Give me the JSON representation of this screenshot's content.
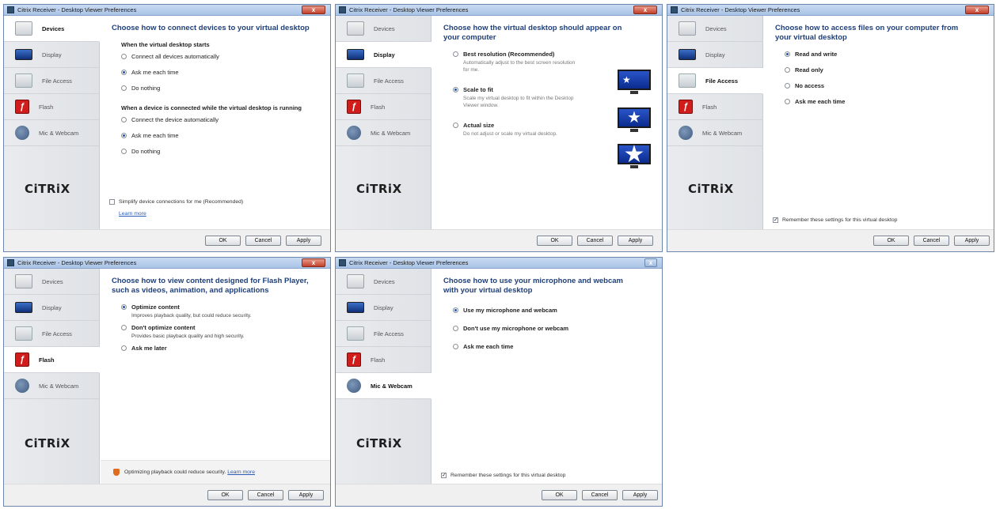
{
  "window_title": "Citrix Receiver - Desktop Viewer Preferences",
  "close_glyph": "x",
  "nav": [
    "Devices",
    "Display",
    "File Access",
    "Flash",
    "Mic & Webcam"
  ],
  "logo_text": "CiTRiX",
  "buttons": {
    "ok": "OK",
    "cancel": "Cancel",
    "apply": "Apply"
  },
  "devices": {
    "heading": "Choose how to connect devices to your virtual desktop",
    "group1_label": "When the virtual desktop starts",
    "group1_options": [
      "Connect all devices automatically",
      "Ask me each time",
      "Do nothing"
    ],
    "group1_selected": 1,
    "group2_label": "When a device is connected while the virtual desktop is running",
    "group2_options": [
      "Connect the device automatically",
      "Ask me each time",
      "Do nothing"
    ],
    "group2_selected": 1,
    "simplify_label": "Simplify device connections for me (Recommended)",
    "learn_more": "Learn more"
  },
  "display": {
    "heading": "Choose how the virtual desktop should appear on your computer",
    "options": [
      {
        "label": "Best resolution (Recommended)",
        "desc": "Automatically adjust to the best screen resolution for me."
      },
      {
        "label": "Scale to fit",
        "desc": "Scale my virtual desktop to fit within the Desktop Viewer window."
      },
      {
        "label": "Actual size",
        "desc": "Do not adjust or scale my virtual desktop."
      }
    ],
    "selected": 1,
    "star_glyph": "★"
  },
  "file_access": {
    "heading": "Choose how to access files on your computer from your virtual desktop",
    "options": [
      "Read and write",
      "Read only",
      "No access",
      "Ask me each time"
    ],
    "selected": 0,
    "remember_label": "Remember these settings for this virtual desktop"
  },
  "flash": {
    "heading": "Choose how to view content designed for Flash Player, such as videos, animation, and applications",
    "options": [
      {
        "label": "Optimize content",
        "desc": "Improves playback quality, but could reduce security."
      },
      {
        "label": "Don't optimize content",
        "desc": "Provides basic playback quality and high security."
      },
      {
        "label": "Ask me later",
        "desc": ""
      }
    ],
    "selected": 0,
    "warning_text": "Optimizing playback could reduce security.",
    "learn_more": "Learn more"
  },
  "mic": {
    "heading": "Choose how to use your microphone and webcam with your virtual desktop",
    "options": [
      "Use my microphone and webcam",
      "Don't use my microphone or webcam",
      "Ask me each time"
    ],
    "selected": 0,
    "remember_label": "Remember these settings for this virtual desktop"
  },
  "colors": {
    "heading": "#1e3f7a",
    "link": "#2a5bb5",
    "flash_red": "#d11c1c",
    "monitor_blue": "#0b2b8e"
  }
}
